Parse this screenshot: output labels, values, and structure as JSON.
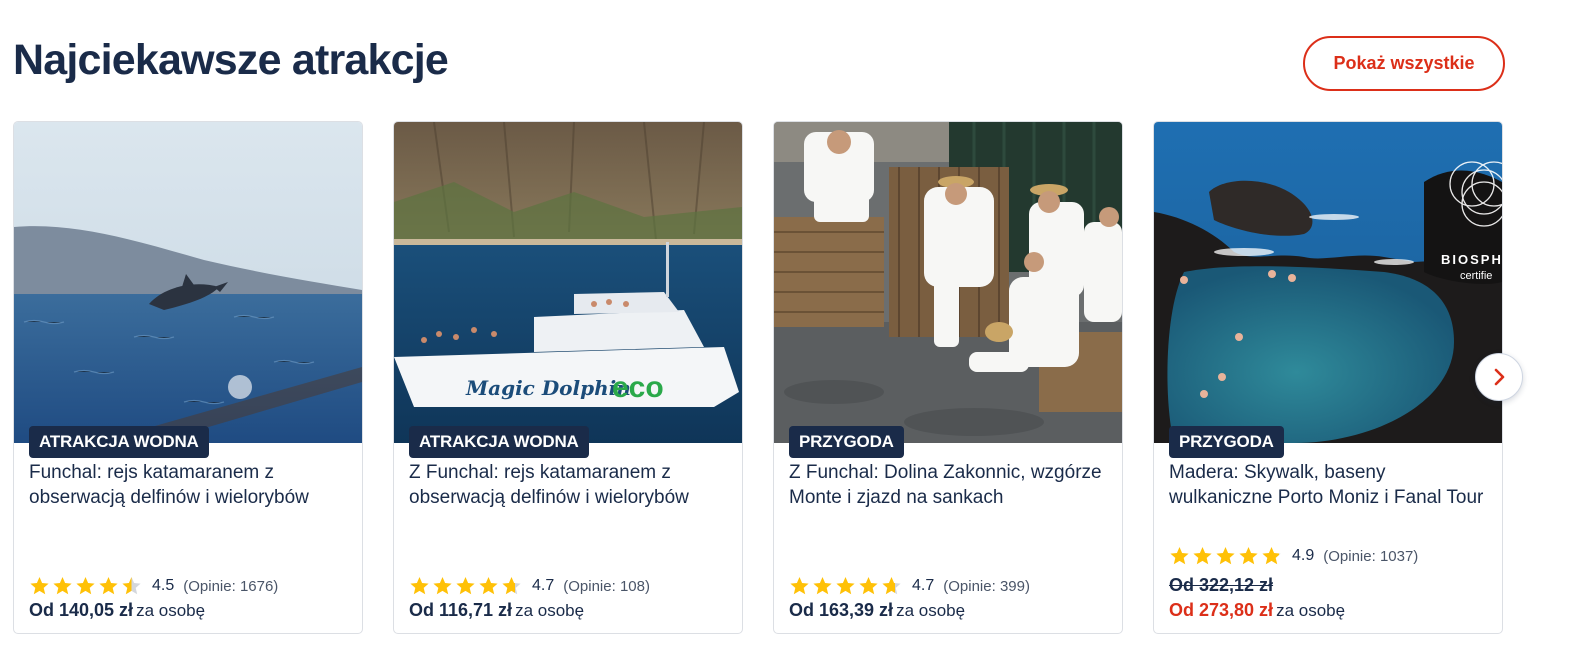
{
  "section": {
    "title": "Najciekawsze atrakcje",
    "show_all_label": "Pokaż wszystkie"
  },
  "colors": {
    "brand_navy": "#1a2b49",
    "accent_red": "#dc2f19",
    "star_yellow": "#ffc107"
  },
  "cards": [
    {
      "badge": "ATRAKCJA WODNA",
      "title": "Funchal: rejs katamaranem z obserwacją delfinów i wielorybów",
      "rating": "4.5",
      "rating_value": 4.5,
      "reviews": "(Opinie: 1676)",
      "old_price": "",
      "price": "Od 140,05 zł",
      "per": "za osobę",
      "image": "dolphin-jumping-ocean"
    },
    {
      "badge": "ATRAKCJA WODNA",
      "title": "Z Funchal: rejs katamaranem z obserwacją delfinów i wielorybów",
      "rating": "4.7",
      "rating_value": 4.7,
      "reviews": "(Opinie: 108)",
      "old_price": "",
      "price": "Od 116,71 zł",
      "per": "za osobę",
      "image": "catamaran-magic-dolphin-eco",
      "image_text_1": "Magic Dolphin",
      "image_text_2": "eco"
    },
    {
      "badge": "PRZYGODA",
      "title": "Z Funchal: Dolina Zakonnic, wzgórze Monte i zjazd na sankach",
      "rating": "4.7",
      "rating_value": 4.7,
      "reviews": "(Opinie: 399)",
      "old_price": "",
      "price": "Od 163,39 zł",
      "per": "za osobę",
      "image": "monte-toboggan-drivers"
    },
    {
      "badge": "PRZYGODA",
      "title": "Madera: Skywalk, baseny wulkaniczne Porto Moniz i Fanal Tour",
      "rating": "4.9",
      "rating_value": 4.9,
      "reviews": "(Opinie: 1037)",
      "old_price": "Od 322,12 zł",
      "price": "Od 273,80 zł",
      "per": "za osobę",
      "image": "porto-moniz-lava-pools",
      "image_text_1": "BIOSPH",
      "image_text_2": "certifie"
    }
  ],
  "carousel": {
    "next_icon": "chevron-right-icon"
  }
}
